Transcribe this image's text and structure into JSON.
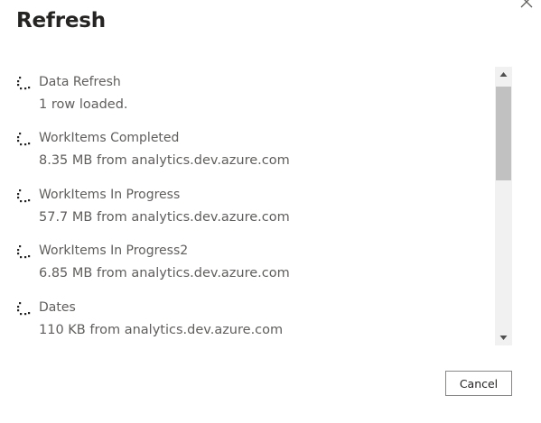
{
  "dialog": {
    "title": "Refresh",
    "close_icon": "close-icon",
    "cancel_label": "Cancel"
  },
  "items": [
    {
      "name": "Data Refresh",
      "status": "1 row loaded.",
      "icon": "loading-spinner-icon"
    },
    {
      "name": "WorkItems Completed",
      "status": "8.35 MB from analytics.dev.azure.com",
      "icon": "loading-spinner-icon"
    },
    {
      "name": "WorkItems In Progress",
      "status": "57.7 MB from analytics.dev.azure.com",
      "icon": "loading-spinner-icon"
    },
    {
      "name": "WorkItems In Progress2",
      "status": "6.85 MB from analytics.dev.azure.com",
      "icon": "loading-spinner-icon"
    },
    {
      "name": "Dates",
      "status": "110 KB from analytics.dev.azure.com",
      "icon": "loading-spinner-icon"
    }
  ],
  "scrollbar": {
    "up_icon": "scroll-up-arrow-icon",
    "down_icon": "scroll-down-arrow-icon"
  },
  "colors": {
    "text_primary": "#252423",
    "text_secondary": "#605e5c",
    "scroll_track": "#f1f1f1",
    "scroll_thumb": "#c1c1c1",
    "button_border": "#8a8886"
  }
}
